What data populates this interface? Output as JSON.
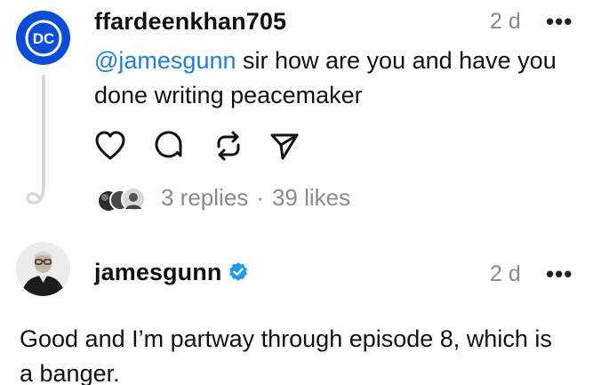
{
  "post": {
    "username": "ffardeenkhan705",
    "avatar_text": "DC",
    "time": "2 d",
    "more": "•••",
    "mention": "@jamesgunn",
    "text_line1_rest": " sir how are you and have you",
    "text_line2": "done writing peacemaker",
    "replies": "3 replies",
    "separator": "·",
    "likes": "39 likes",
    "icons": [
      "heart-icon",
      "comment-icon",
      "repost-icon",
      "share-icon"
    ]
  },
  "reply": {
    "username": "jamesgunn",
    "time": "2 d",
    "more": "•••",
    "text_line1": "Good and I’m partway through episode 8, which is",
    "text_line2": "a banger.",
    "verified_icon": "verified-badge-icon"
  },
  "colors": {
    "dc_blue": "#0a4ed8",
    "mention_blue": "#1d7fd6",
    "verified_blue": "#1d9bf0",
    "muted_gray": "#8a8a8a",
    "thread_line": "#d9d9d9"
  }
}
